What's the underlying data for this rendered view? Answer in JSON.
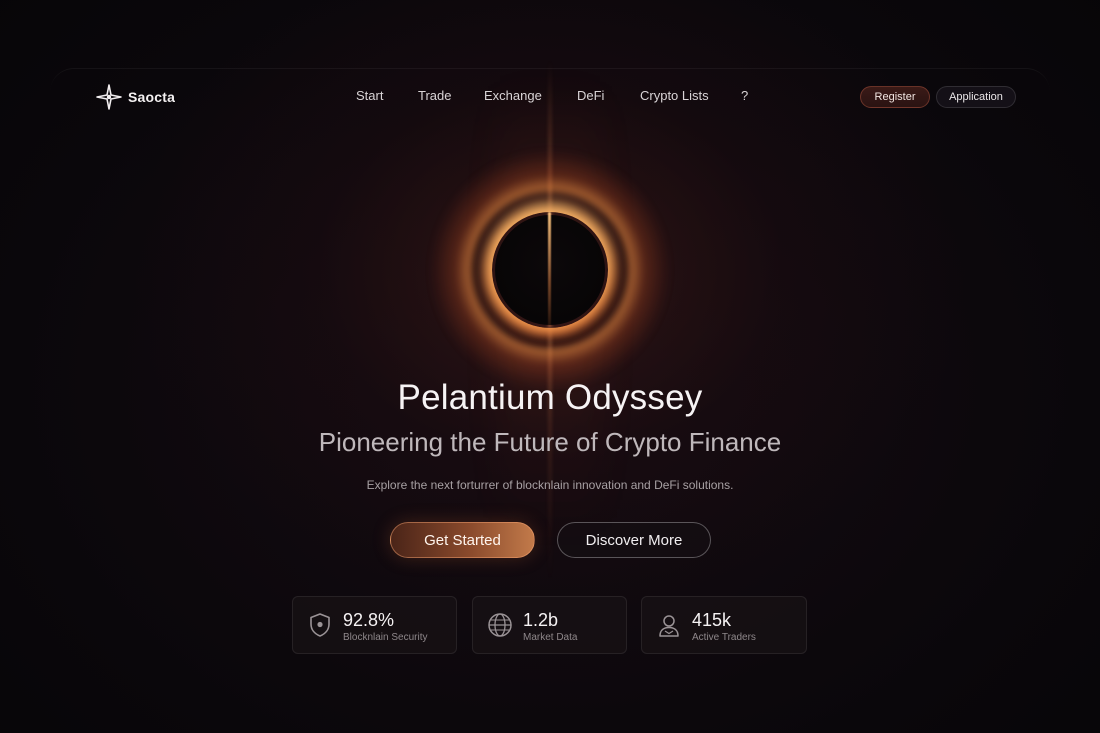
{
  "brand": {
    "name": "Saocta",
    "logo_icon": "diamond-compass-icon"
  },
  "nav": {
    "items": [
      {
        "label": "Start"
      },
      {
        "label": "Trade"
      },
      {
        "label": "Exchange"
      },
      {
        "label": "DeFi"
      },
      {
        "label": "Crypto Lists"
      },
      {
        "label": "?"
      }
    ],
    "register_label": "Register",
    "application_label": "Application"
  },
  "hero": {
    "title": "Pelantium Odyssey",
    "subtitle": "Pioneering the Future of Crypto Finance",
    "description": "Explore the next forturrer of blocknlain innovation and DeFi solutions.",
    "primary_cta": "Get Started",
    "secondary_cta": "Discover More"
  },
  "stats": [
    {
      "value": "92.8%",
      "label": "Blocknlain Security",
      "icon": "shield-icon"
    },
    {
      "value": "1.2b",
      "label": "Market Data",
      "icon": "globe-icon"
    },
    {
      "value": "415k",
      "label": "Active Traders",
      "icon": "user-icon"
    }
  ],
  "colors": {
    "background": "#070508",
    "accent": "#c27a4a",
    "eclipse_glow": "#ffb46e"
  }
}
